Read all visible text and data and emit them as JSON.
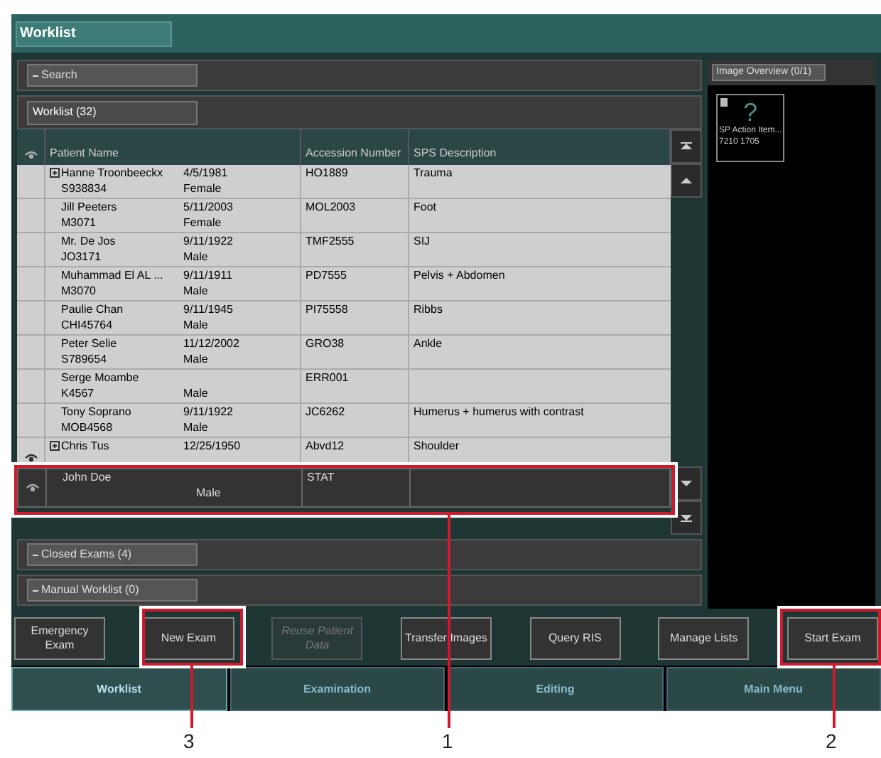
{
  "window": {
    "title": "Worklist"
  },
  "sections": {
    "search": {
      "label": "Search",
      "expanded": true
    },
    "worklist": {
      "label": "Worklist (32)"
    }
  },
  "table": {
    "columns": [
      "Patient Name",
      "Accession Number",
      "SPS Description"
    ],
    "rows": [
      {
        "name": "Hanne Troonbeeckx",
        "id": "S938834",
        "dob": "4/5/1981",
        "sex": "Female",
        "accession": "HO1889",
        "sps": "Trauma",
        "expandable": true,
        "viewed": false
      },
      {
        "name": "Jill Peeters",
        "id": "M3071",
        "dob": "5/11/2003",
        "sex": "Female",
        "accession": "MOL2003",
        "sps": "Foot",
        "expandable": false,
        "viewed": false
      },
      {
        "name": "Mr. De Jos",
        "id": "JO3171",
        "dob": "9/11/1922",
        "sex": "Male",
        "accession": "TMF2555",
        "sps": "SIJ",
        "expandable": false,
        "viewed": false
      },
      {
        "name": "Muhammad El AL ...",
        "id": "M3070",
        "dob": "9/11/1911",
        "sex": "Male",
        "accession": "PD7555",
        "sps": "Pelvis + Abdomen",
        "expandable": false,
        "viewed": false
      },
      {
        "name": "Paulie Chan",
        "id": "CHI45764",
        "dob": "9/11/1945",
        "sex": "Male",
        "accession": "PI75558",
        "sps": "Ribbs",
        "expandable": false,
        "viewed": false
      },
      {
        "name": "Peter Selie",
        "id": "S789654",
        "dob": "11/12/2002",
        "sex": "Male",
        "accession": "GRO38",
        "sps": "Ankle",
        "expandable": false,
        "viewed": false
      },
      {
        "name": "Serge Moambe",
        "id": "K4567",
        "sex": "Male",
        "accession": "ERR001",
        "expandable": false,
        "viewed": false
      },
      {
        "name": "Tony Soprano",
        "id": "MOB4568",
        "dob": "9/11/1922",
        "sex": "Male",
        "accession": "JC6262",
        "sps": "Humerus + humerus with contrast",
        "expandable": false,
        "viewed": false
      },
      {
        "name": "Chris Tus",
        "dob": "12/25/1950",
        "accession": "Abvd12",
        "sps": "Shoulder",
        "expandable": true,
        "viewed": true
      }
    ],
    "pinned_row": {
      "name": "John Doe",
      "sex": "Male",
      "accession": "STAT",
      "viewed": true
    }
  },
  "lower_sections": [
    {
      "label": "Closed Exams (4)"
    },
    {
      "label": "Manual Worklist (0)"
    }
  ],
  "image_overview": {
    "title": "Image Overview (0/1)",
    "thumbnail": {
      "line1": "SP Action Item...",
      "line2": "7210 1705",
      "glyph": "?"
    }
  },
  "buttons": [
    {
      "label": "Emergency Exam",
      "disabled": false
    },
    {
      "label": "New Exam",
      "disabled": false
    },
    {
      "label": "Reuse Patient Data",
      "disabled": true
    },
    {
      "label": "Transfer Images",
      "disabled": false
    },
    {
      "label": "Query RIS",
      "disabled": false
    },
    {
      "label": "Manage Lists",
      "disabled": false
    },
    {
      "label": "Start Exam",
      "disabled": false
    }
  ],
  "tabs": [
    {
      "label": "Worklist",
      "selected": true
    },
    {
      "label": "Examination",
      "selected": false
    },
    {
      "label": "Editing",
      "selected": false
    },
    {
      "label": "Main Menu",
      "selected": false
    }
  ],
  "callouts": [
    {
      "label": "3"
    },
    {
      "label": "1"
    },
    {
      "label": "2"
    }
  ]
}
